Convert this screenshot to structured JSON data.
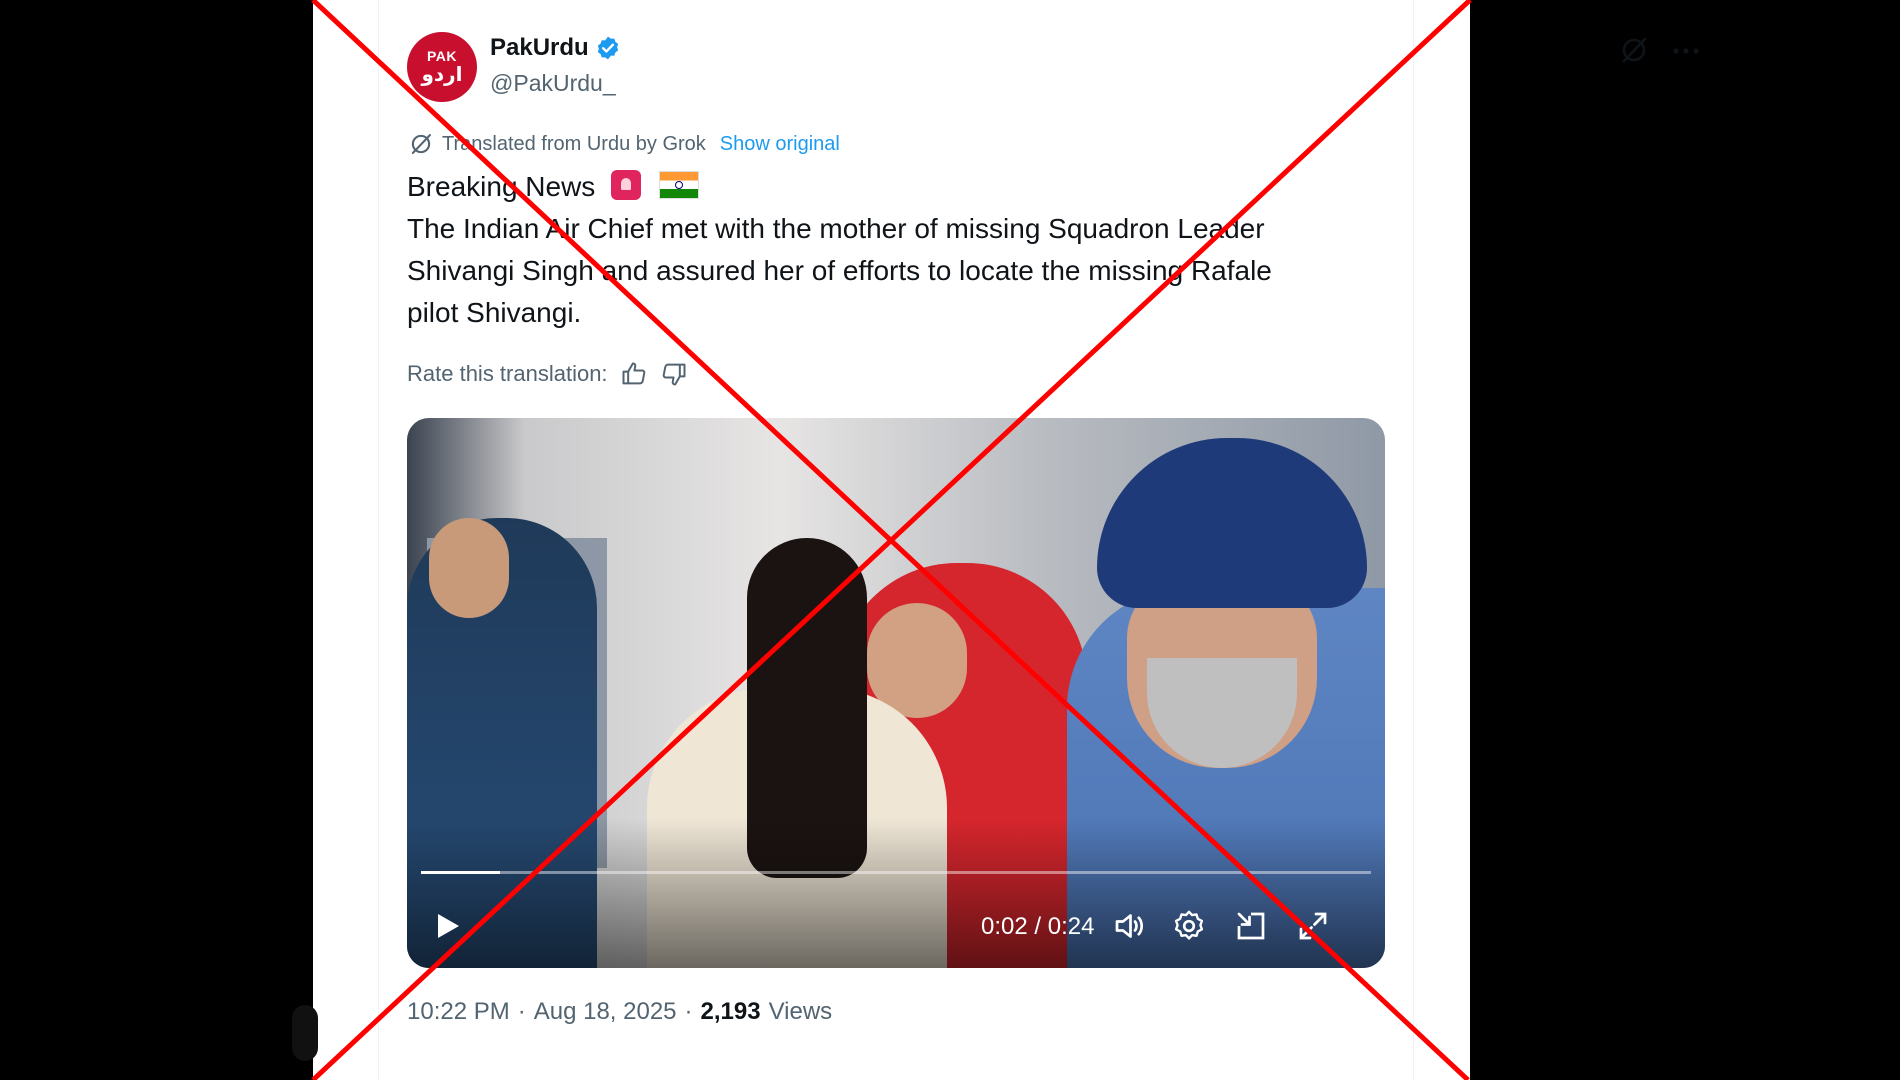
{
  "account": {
    "avatar_text_top": "PAK",
    "avatar_text_bottom": "اردو",
    "display_name": "PakUrdu",
    "handle": "@PakUrdu_"
  },
  "translation": {
    "label": "Translated from Urdu by Grok",
    "show_original": "Show original",
    "rate_label": "Rate this translation:"
  },
  "tweet": {
    "headline": "Breaking News",
    "lines": [
      "The Indian Air Chief met with the mother of missing Squadron Leader",
      "Shivangi Singh and assured her of efforts to locate the missing Rafale",
      "pilot Shivangi."
    ]
  },
  "video": {
    "time": "0:02 / 0:24",
    "progress_fraction": 0.083
  },
  "meta": {
    "time": "10:22 PM",
    "date": "Aug 18, 2025",
    "views_count": "2,193",
    "views_label": "Views",
    "separator": "·"
  },
  "colors": {
    "link": "#1d9bf0",
    "muted": "#536471",
    "text": "#0f1419",
    "cross": "#ff0000",
    "avatar_bg": "#c8102e"
  },
  "icons": {
    "verified": "verified-badge-icon",
    "grok": "grok-icon",
    "more": "more-icon",
    "thumbs_up": "thumbs-up-icon",
    "thumbs_down": "thumbs-down-icon",
    "play": "play-icon",
    "volume": "volume-icon",
    "settings": "settings-icon",
    "dock": "dock-icon",
    "fullscreen": "fullscreen-icon"
  }
}
